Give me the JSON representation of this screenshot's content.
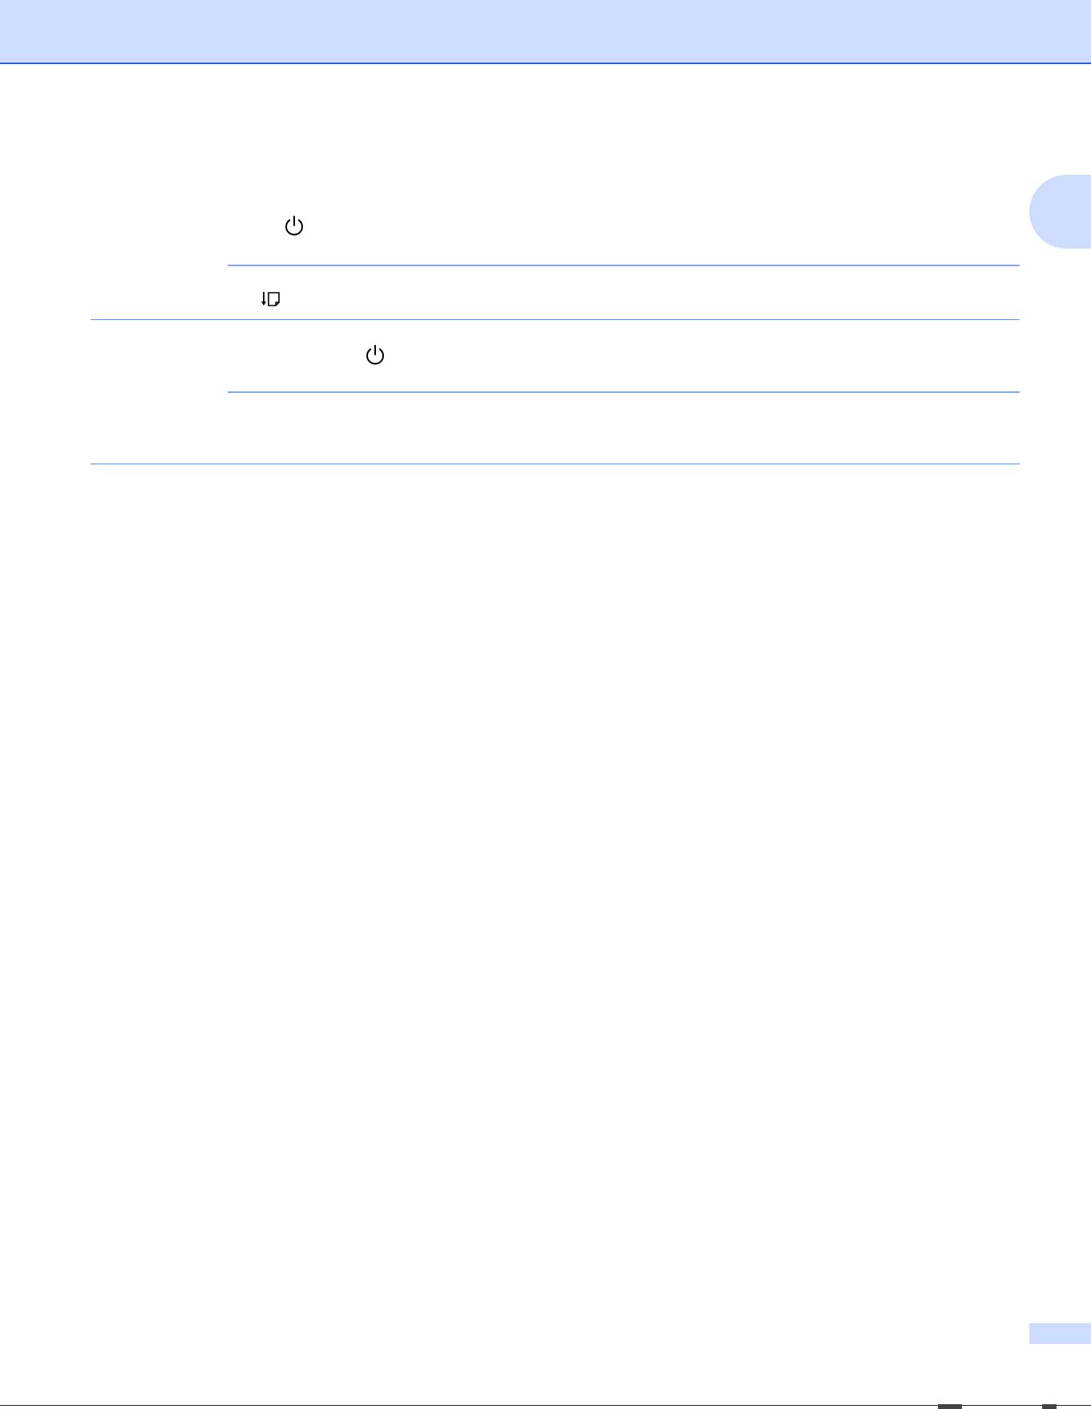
{
  "page": {
    "accent_color": "#cddcff",
    "rule_color": "#86a6f2",
    "header_border_color": "#2a5bd7"
  },
  "icons": {
    "power_1": "power-icon",
    "feed": "paper-feed-icon",
    "power_2": "power-icon"
  }
}
